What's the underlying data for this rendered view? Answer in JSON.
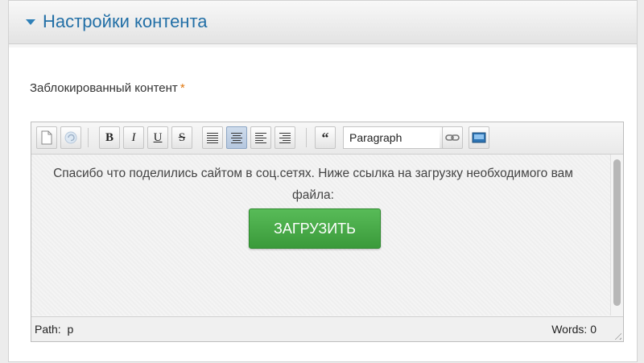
{
  "panel": {
    "title": "Настройки контента"
  },
  "field": {
    "label": "Заблокированный контент",
    "required_mark": "*"
  },
  "toolbar": {
    "buttons": [
      {
        "name": "new-document-icon"
      },
      {
        "name": "undo-icon"
      },
      {
        "name": "bold",
        "label": "B"
      },
      {
        "name": "italic",
        "label": "I"
      },
      {
        "name": "underline",
        "label": "U"
      },
      {
        "name": "strikethrough",
        "label": "S"
      },
      {
        "name": "align-justify-icon"
      },
      {
        "name": "align-center-icon",
        "active": true
      },
      {
        "name": "align-left-icon"
      },
      {
        "name": "align-right-icon"
      },
      {
        "name": "blockquote",
        "label": "“"
      },
      {
        "name": "link-icon"
      },
      {
        "name": "image-icon"
      }
    ],
    "format_select": "Paragraph"
  },
  "content": {
    "text": "Спасибо что поделились сайтом в соц.сетях. Ниже ссылка на загрузку необходимого вам файла:",
    "button_label": "ЗАГРУЗИТЬ",
    "button_color": "#4aab4a"
  },
  "status": {
    "path_label": "Path:",
    "path_value": "p",
    "words_label": "Words:",
    "words_value": "0"
  },
  "colors": {
    "accent": "#226fa6",
    "required": "#e0780f"
  }
}
